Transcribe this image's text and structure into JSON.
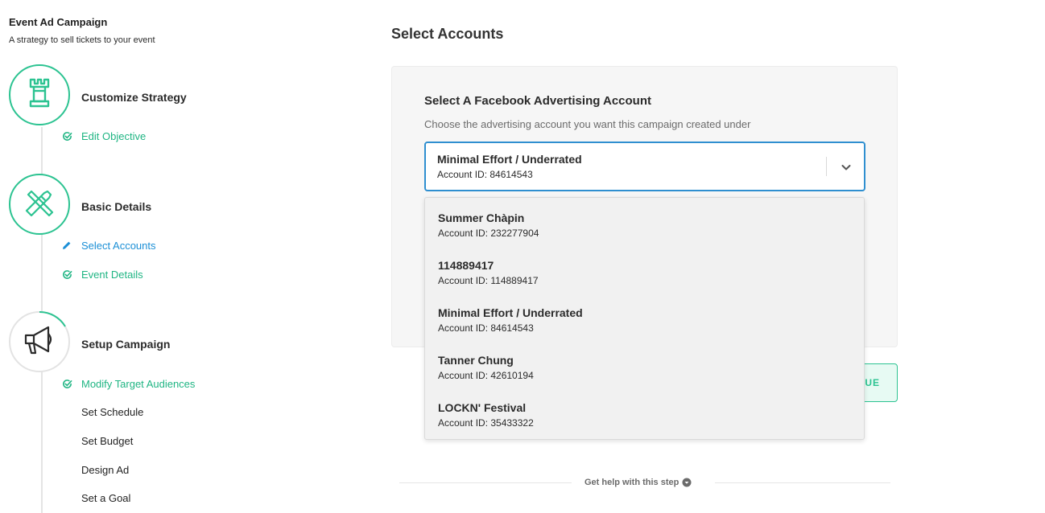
{
  "sidebar": {
    "campaign_title": "Event Ad Campaign",
    "campaign_subtitle": "A strategy to sell tickets to your event",
    "steps": [
      {
        "title": "Customize Strategy",
        "icon": "rook-icon",
        "items": [
          {
            "label": "Edit Objective",
            "state": "completed"
          }
        ]
      },
      {
        "title": "Basic Details",
        "icon": "tools-icon",
        "items": [
          {
            "label": "Select Accounts",
            "state": "current"
          },
          {
            "label": "Event Details",
            "state": "completed"
          }
        ]
      },
      {
        "title": "Setup Campaign",
        "icon": "megaphone-icon",
        "items": [
          {
            "label": "Modify Target Audiences",
            "state": "completed"
          },
          {
            "label": "Set Schedule",
            "state": "pending"
          },
          {
            "label": "Set Budget",
            "state": "pending"
          },
          {
            "label": "Design Ad",
            "state": "pending"
          },
          {
            "label": "Set a Goal",
            "state": "pending"
          }
        ]
      }
    ]
  },
  "main": {
    "title": "Select Accounts",
    "card": {
      "heading": "Select A Facebook Advertising Account",
      "description": "Choose the advertising account you want this campaign created under",
      "selected": {
        "name": "Minimal Effort / Underrated",
        "account_id": "Account ID: 84614543"
      }
    },
    "dropdown_options": [
      {
        "name": "Summer Chàpin",
        "account_id": "Account ID: 232277904"
      },
      {
        "name": "114889417",
        "account_id": "Account ID: 114889417"
      },
      {
        "name": "Minimal Effort / Underrated",
        "account_id": "Account ID: 84614543"
      },
      {
        "name": "Tanner Chung",
        "account_id": "Account ID: 42610194"
      },
      {
        "name": "LOCKN' Festival",
        "account_id": "Account ID: 35433322"
      }
    ],
    "continue_label_visible": "UE",
    "help_text": "Get help with this step"
  },
  "colors": {
    "accent_green": "#2cc391",
    "accent_blue": "#2f8fd0",
    "link_blue": "#1b8fd6"
  }
}
